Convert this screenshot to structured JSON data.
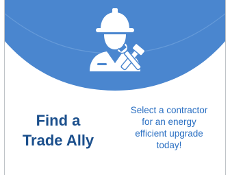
{
  "card": {
    "title_line1": "Find a",
    "title_line2": "Trade Ally",
    "desc_line1": "Select a contractor",
    "desc_line2": "for an energy",
    "desc_line3": "efficient upgrade",
    "desc_line4": "today!"
  },
  "icon": {
    "name": "worker-hardhat-tools-icon"
  },
  "colors": {
    "hero_blue": "#4a86cf",
    "title": "#1b4f8c",
    "description": "#2a6fc2"
  }
}
